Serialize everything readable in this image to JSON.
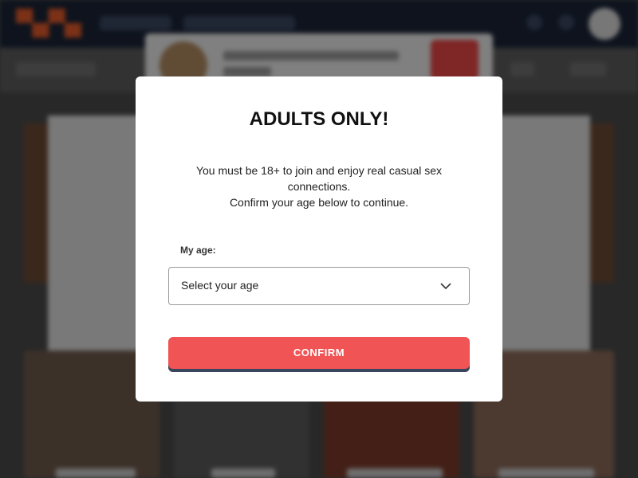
{
  "modal": {
    "title": "ADULTS ONLY!",
    "message_line1": "You must be 18+ to join and enjoy real casual sex",
    "message_line2": "connections.",
    "message_line3": "Confirm your age below to continue.",
    "age_label": "My age:",
    "age_select_value": "Select your age",
    "confirm_label": "CONFIRM"
  },
  "icons": {
    "chevron": "chevron-down-icon"
  },
  "colors": {
    "confirm_button": "#f05454",
    "topbar": "#1a2436",
    "overlay": "rgba(0,0,0,0.45)"
  }
}
